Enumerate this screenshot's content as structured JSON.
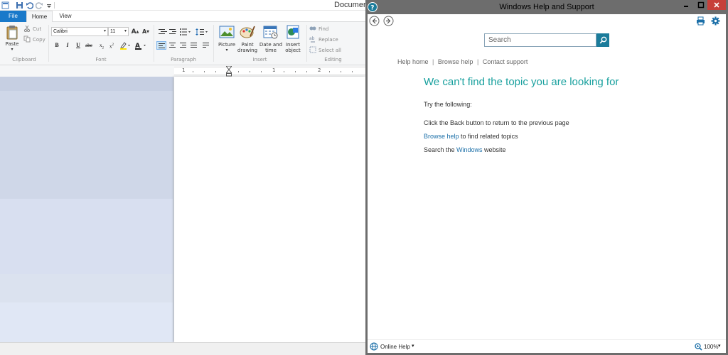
{
  "wordpad": {
    "title": "Documen",
    "tabs": {
      "file": "File",
      "home": "Home",
      "view": "View"
    },
    "clipboard": {
      "paste": "Paste",
      "cut": "Cut",
      "copy": "Copy",
      "group": "Clipboard"
    },
    "font": {
      "family": "Calibri",
      "size": "11",
      "group": "Font"
    },
    "paragraph": {
      "group": "Paragraph"
    },
    "insert": {
      "picture": "Picture",
      "paint": "Paint drawing",
      "datetime": "Date and time",
      "object": "Insert object",
      "group": "Insert"
    },
    "editing": {
      "find": "Find",
      "replace": "Replace",
      "select_all": "Select all",
      "group": "Editing"
    },
    "ruler": {
      "n1": "1",
      "n2": "2"
    },
    "colors": {
      "file_tab": "#1979ca",
      "workspace": "#dde3ef"
    }
  },
  "help": {
    "title": "Windows Help and Support",
    "search": {
      "placeholder": "Search"
    },
    "links": {
      "home": "Help home",
      "browse": "Browse help",
      "contact": "Contact support",
      "separator": "|"
    },
    "heading": "We can't find the topic you are looking for",
    "try": "Try the following:",
    "back_line": "Click the Back button to return to the previous page",
    "browse_link": "Browse help",
    "browse_rest": " to find related topics",
    "search_pre": "Search the ",
    "search_link": "Windows",
    "search_post": " website",
    "footer": {
      "online": "Online Help",
      "zoom": "100%"
    },
    "colors": {
      "heading": "#18a09e",
      "link": "#1b6fa8",
      "search_button": "#1b7c9b",
      "close_button": "#c7403a"
    }
  }
}
